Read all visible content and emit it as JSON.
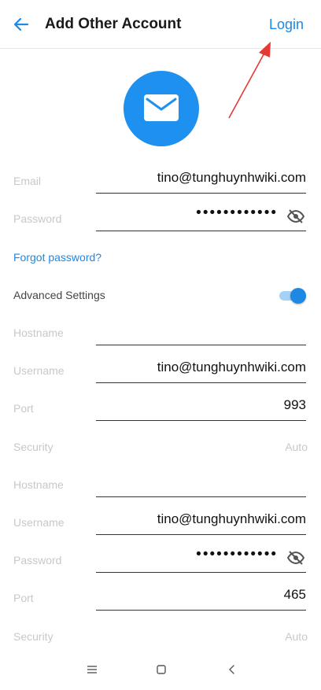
{
  "header": {
    "title": "Add Other Account",
    "login_label": "Login",
    "back_icon": "arrow-left-icon"
  },
  "avatar": {
    "icon": "mail-icon",
    "color": "#1e90f0"
  },
  "account": {
    "email_label": "Email",
    "email_value": "tino@tunghuynhwiki.com",
    "password_label": "Password",
    "password_value": "••••••••••••",
    "forgot_label": "Forgot password?"
  },
  "advanced": {
    "label": "Advanced Settings",
    "enabled": true
  },
  "incoming": {
    "hostname_label": "Hostname",
    "hostname_value": "",
    "username_label": "Username",
    "username_value": "tino@tunghuynhwiki.com",
    "port_label": "Port",
    "port_value": "993",
    "security_label": "Security",
    "security_value": "Auto"
  },
  "outgoing": {
    "hostname_label": "Hostname",
    "hostname_value": "",
    "username_label": "Username",
    "username_value": "tino@tunghuynhwiki.com",
    "password_label": "Password",
    "password_value": "••••••••••••",
    "port_label": "Port",
    "port_value": "465",
    "security_label": "Security",
    "security_value": "Auto"
  },
  "colors": {
    "accent": "#1e88e5",
    "annotation_arrow": "#e53935"
  }
}
